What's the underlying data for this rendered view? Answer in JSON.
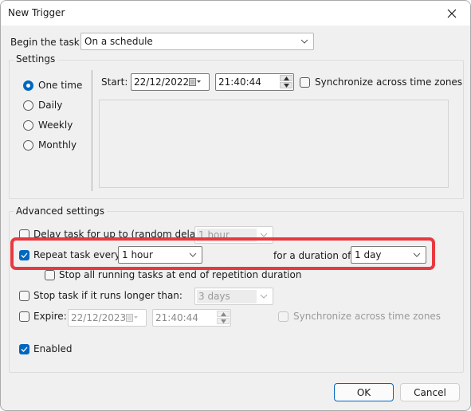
{
  "window": {
    "title": "New Trigger",
    "close_icon": "close-icon"
  },
  "begin": {
    "label": "Begin the task:",
    "value": "On a schedule"
  },
  "settings": {
    "legend": "Settings",
    "schedule_options": [
      {
        "label": "One time",
        "checked": true
      },
      {
        "label": "Daily",
        "checked": false
      },
      {
        "label": "Weekly",
        "checked": false
      },
      {
        "label": "Monthly",
        "checked": false
      }
    ],
    "start_label": "Start:",
    "start_date": "22/12/2022",
    "start_time": "21:40:44",
    "sync_label": "Synchronize across time zones",
    "sync_checked": false
  },
  "advanced": {
    "legend": "Advanced settings",
    "delay": {
      "label": "Delay task for up to (random delay):",
      "checked": false,
      "value": "1 hour",
      "enabled": false
    },
    "repeat": {
      "label": "Repeat task every:",
      "checked": true,
      "value": "1 hour",
      "duration_label": "for a duration of:",
      "duration_value": "1 day"
    },
    "stop_all": {
      "label": "Stop all running tasks at end of repetition duration",
      "checked": false
    },
    "stop_longer": {
      "label": "Stop task if it runs longer than:",
      "checked": false,
      "value": "3 days",
      "enabled": false
    },
    "expire": {
      "label": "Expire:",
      "checked": false,
      "date": "22/12/2023",
      "time": "21:40:44",
      "sync_label": "Synchronize across time zones",
      "sync_checked": false,
      "enabled": false
    },
    "enabled": {
      "label": "Enabled",
      "checked": true
    }
  },
  "buttons": {
    "ok": "OK",
    "cancel": "Cancel"
  },
  "colors": {
    "accent": "#0067c0",
    "highlight": "#e8393f",
    "background": "#f0f0f0"
  }
}
